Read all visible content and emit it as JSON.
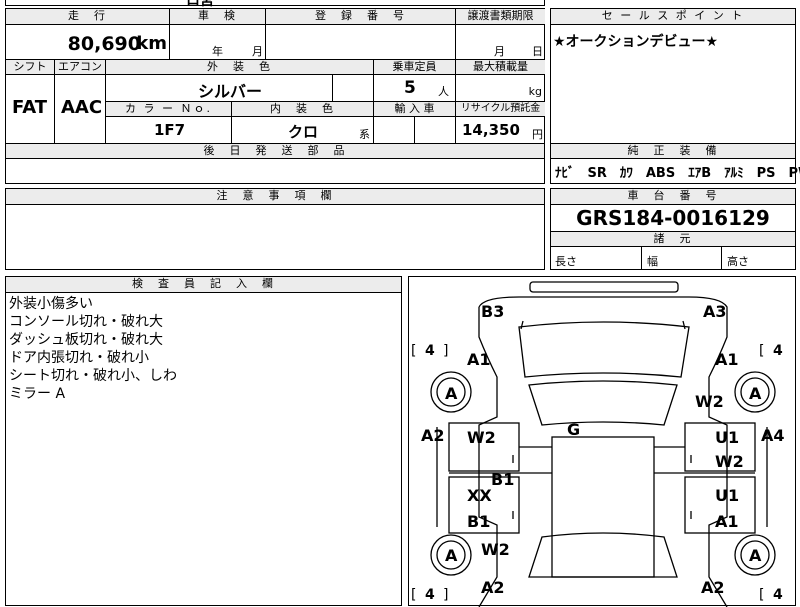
{
  "sheet": {
    "top_partial": "ロ宮",
    "mileage_header": "走　行",
    "mileage_value": "80,690",
    "mileage_unit": "km",
    "inspection_header": "車　検",
    "inspection_year_label": "年",
    "inspection_month_label": "月",
    "registration_header": "登　録　番　号",
    "transfer_header": "譲渡書類期限",
    "transfer_month_label": "月",
    "transfer_day_label": "日",
    "shift_header": "シフト",
    "aircon_header": "エアコン",
    "exterior_color_header": "外　装　色",
    "capacity_header": "乗車定員",
    "max_load_header": "最大積載量",
    "shift_value": "FAT",
    "aircon_value": "AAC",
    "exterior_color_value": "シルバー",
    "capacity_value": "5",
    "capacity_unit": "人",
    "max_load_unit": "kg",
    "color_no_header": "カ ラ ー Ｎｏ.",
    "interior_color_header": "内　装　色",
    "import_header": "輸 入 車",
    "recycle_header": "リサイクル預託金",
    "color_no_value": "1F7",
    "interior_color_value": "クロ",
    "interior_color_suffix": "系",
    "recycle_value": "14,350",
    "recycle_unit": "円",
    "parts_header": "後　日　発　送　部　品",
    "sales_point_header": "セ ー ル ス ポ イ ン ト",
    "sales_point_text": "★オークションデビュー★",
    "equipment_header": "純　正　装　備",
    "equipment_text": "ﾅﾋﾞ　SR　ｶﾜ　ABS　ｴｱB　ｱﾙﾐ　PS　PW",
    "caution_header": "注　意　事　項　欄",
    "chassis_header": "車　台　番　号",
    "chassis_value": "GRS184-0016129",
    "dimensions_header": "諸　元",
    "length_label": "長さ",
    "width_label": "幅",
    "height_label": "高さ",
    "inspector_header": "検　査　員　記　入　欄",
    "inspector_notes": [
      "外装小傷多い",
      "コンソール切れ・破れ大",
      "ダッシュ板切れ・破れ大",
      "ドア内張切れ・破れ小",
      "シート切れ・破れ小、しわ",
      "ミラー A"
    ]
  },
  "diagram": {
    "labels": {
      "b3": "B3",
      "a3": "A3",
      "tire_fl_depth": "4",
      "tire_fr_depth": "4",
      "tire_rl_depth": "4",
      "tire_rr_depth": "4",
      "a1_front_left": "A1",
      "a1_front_right": "A1",
      "tire_fl_grade": "A",
      "tire_fr_grade": "A",
      "tire_rl_grade": "A",
      "tire_rr_grade": "A",
      "w2_front_right_fender": "W2",
      "a2_left_side": "A2",
      "a4_right_side": "A4",
      "w2_front_left_door": "W2",
      "u1_front_right_door": "U1",
      "w2_front_right_door": "W2",
      "g_roof": "G",
      "b1_left_sill": "B1",
      "xx_rear_left_door": "XX",
      "u1_rear_right_door": "U1",
      "b1_rear_left_door": "B1",
      "a1_rear_right_door": "A1",
      "w2_rear_left_fender": "W2",
      "a2_rear_left": "A2",
      "a2_rear_right": "A2"
    }
  }
}
